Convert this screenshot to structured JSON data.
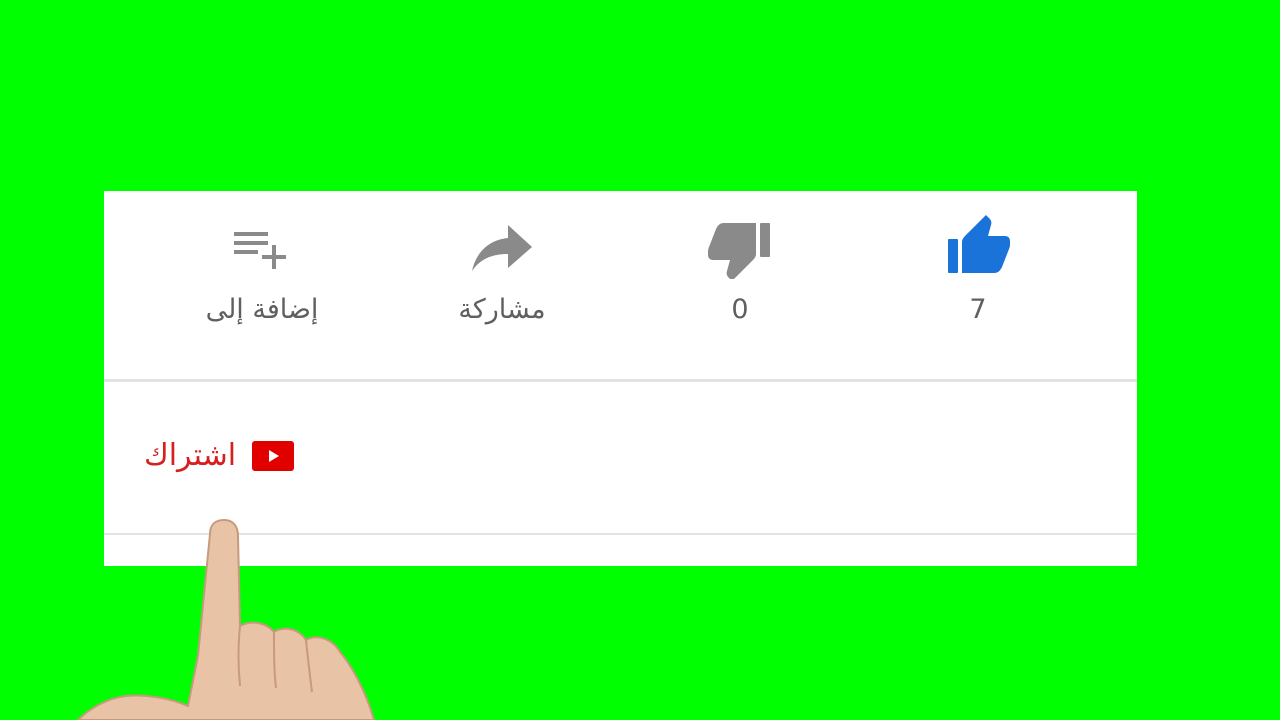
{
  "actions": {
    "add_to": {
      "label": "إضافة إلى",
      "icon": "playlist-add-icon"
    },
    "share": {
      "label": "مشاركة",
      "icon": "share-arrow-icon"
    },
    "dislike": {
      "count": "0",
      "icon": "thumbs-down-icon"
    },
    "like": {
      "count": "7",
      "icon": "thumbs-up-icon"
    }
  },
  "subscribe": {
    "label": "اشتراك",
    "icon": "youtube-logo-icon"
  },
  "colors": {
    "background": "#00ff00",
    "panel": "#ffffff",
    "icon_gray": "#8a8a8a",
    "like_blue": "#1a73d9",
    "subscribe_red": "#d62020",
    "youtube_red": "#e00000"
  }
}
